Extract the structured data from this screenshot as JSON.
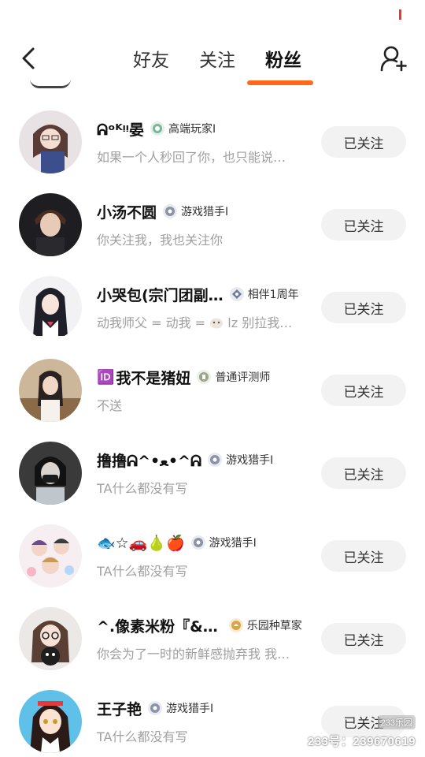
{
  "header": {
    "tabs": [
      {
        "label": "好友"
      },
      {
        "label": "关注"
      },
      {
        "label": "粉丝"
      }
    ],
    "active_tab": "粉丝",
    "accent_color": "#ff6a1a"
  },
  "icons": {
    "back": "chevron-left-icon",
    "add_user": "add-user-icon"
  },
  "followers": [
    {
      "name": "ᕱᵒᴷᵎᵎ晏",
      "badge": "高端玩家Ⅰ",
      "bio": "如果一个人秒回了你，也只能说…",
      "button": "已关注"
    },
    {
      "name": "小汤不圆",
      "badge": "游戏猎手Ⅰ",
      "bio": "你关注我，我也关注你",
      "button": "已关注"
    },
    {
      "name": "小哭包(宗门团副…",
      "badge": "相伴1周年",
      "bio": "动我师父 = 动我 =",
      "bio_tail": "lz 别拉我…",
      "button": "已关注"
    },
    {
      "name": "我不是猪妞",
      "prefix": "🆔",
      "badge": "普通评测师",
      "bio": "不送",
      "button": "已关注"
    },
    {
      "name": "撸撸ᕱ^•ﻌ•^ᕱ",
      "badge": "游戏猎手Ⅰ",
      "bio": "TA什么都没有写",
      "button": "已关注"
    },
    {
      "name": "🐟☆🚗🍐🍎",
      "badge": "游戏猎手Ⅰ",
      "bio": "TA什么都没有写",
      "button": "已关注"
    },
    {
      "name": "^.像素米粉『&…",
      "badge": "乐园种草家",
      "bio": "你会为了一时的新鲜感抛弃我 我…",
      "button": "已关注"
    },
    {
      "name": "王子艳",
      "badge": "游戏猎手Ⅰ",
      "bio": "TA什么都没有写",
      "button": "已关注"
    }
  ],
  "watermark": {
    "logo": "233乐园",
    "id_text": "233号：239670619"
  }
}
